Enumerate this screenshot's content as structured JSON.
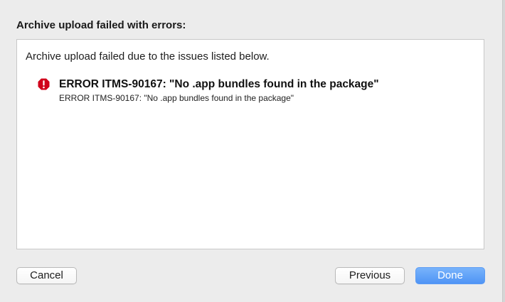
{
  "dialog": {
    "title": "Archive upload failed with errors:"
  },
  "panel": {
    "intro": "Archive upload failed due to the issues listed below.",
    "issues": [
      {
        "icon": "error-icon",
        "title": "ERROR ITMS-90167: \"No .app bundles found in the package\"",
        "detail": "ERROR ITMS-90167: \"No .app bundles found in the package\""
      }
    ]
  },
  "buttons": {
    "cancel": "Cancel",
    "previous": "Previous",
    "done": "Done"
  },
  "colors": {
    "error": "#d0021b",
    "primary_button": "#5a9cf6",
    "background": "#ececec"
  }
}
